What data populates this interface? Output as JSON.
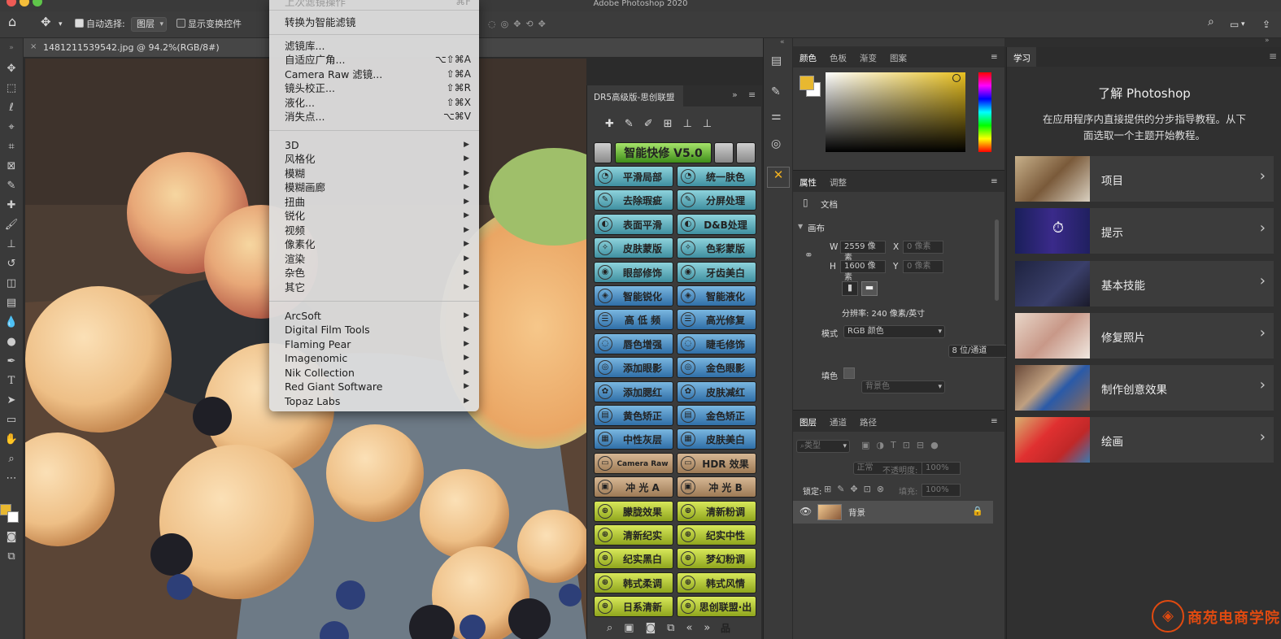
{
  "app": {
    "title": "Adobe Photoshop 2020"
  },
  "options_bar": {
    "auto_select_label": "自动选择:",
    "auto_select_value": "图层",
    "show_transform_label": "显示变换控件"
  },
  "document": {
    "tab_title": "1481211539542.jpg @ 94.2%(RGB/8#)"
  },
  "filter_menu": {
    "top_faded": "上次滤镜操作",
    "top_faded_shortcut": "⌃⌘F",
    "convert_smart": "转换为智能滤镜",
    "items": [
      {
        "label": "滤镜库...",
        "shortcut": ""
      },
      {
        "label": "自适应广角...",
        "shortcut": "⌥⇧⌘A"
      },
      {
        "label": "Camera Raw 滤镜...",
        "shortcut": "⇧⌘A"
      },
      {
        "label": "镜头校正...",
        "shortcut": "⇧⌘R"
      },
      {
        "label": "液化...",
        "shortcut": "⇧⌘X"
      },
      {
        "label": "消失点...",
        "shortcut": "⌥⌘V"
      }
    ],
    "submenus": [
      "3D",
      "风格化",
      "模糊",
      "模糊画廊",
      "扭曲",
      "锐化",
      "视频",
      "像素化",
      "渲染",
      "杂色",
      "其它"
    ],
    "plugins": [
      "ArcSoft",
      "Digital Film Tools",
      "Flaming Pear",
      "Imagenomic",
      "Nik Collection",
      "Red Giant Software",
      "Topaz Labs"
    ]
  },
  "drs_panel": {
    "title": "DR5高级版-思创联盟",
    "header_button": "智能快修 V5.0",
    "buttons": [
      [
        "平滑局部",
        "统一肤色"
      ],
      [
        "去除瑕疵",
        "分屏处理"
      ],
      [
        "表面平滑",
        "D&B处理"
      ],
      [
        "皮肤蒙版",
        "色彩蒙版"
      ],
      [
        "眼部修饰",
        "牙齿美白"
      ],
      [
        "智能锐化",
        "智能液化"
      ],
      [
        "高 低 频",
        "高光修复"
      ],
      [
        "唇色增强",
        "睫毛修饰"
      ],
      [
        "添加眼影",
        "金色眼影"
      ],
      [
        "添加腮红",
        "皮肤减红"
      ],
      [
        "黄色矫正",
        "金色矫正"
      ],
      [
        "中性灰层",
        "皮肤美白"
      ],
      [
        "Camera Raw",
        "HDR 效果"
      ],
      [
        "冲 光 A",
        "冲 光 B"
      ],
      [
        "朦胧效果",
        "清新粉调"
      ],
      [
        "清新纪实",
        "纪实中性"
      ],
      [
        "纪实黑白",
        "梦幻粉调"
      ],
      [
        "韩式柔调",
        "韩式风情"
      ],
      [
        "日系清新",
        "思创联盟·出品"
      ]
    ]
  },
  "color_panel": {
    "tabs": [
      "颜色",
      "色板",
      "渐变",
      "图案"
    ],
    "foreground": "#e8b830",
    "background": "#ffffff"
  },
  "properties_panel": {
    "tabs": [
      "属性",
      "调整"
    ],
    "doc_label": "文档",
    "section": "画布",
    "w_label": "W",
    "w_value": "2559 像素",
    "h_label": "H",
    "h_value": "1600 像素",
    "x_label": "X",
    "x_placeholder": "0 像素",
    "y_label": "Y",
    "y_placeholder": "0 像素",
    "resolution": "分辨率: 240 像素/英寸",
    "mode_label": "模式",
    "mode_value": "RGB 颜色",
    "depth_value": "8 位/通道",
    "fill_label": "填色",
    "fill_value": "背景色"
  },
  "layers_panel": {
    "tabs": [
      "图层",
      "通道",
      "路径"
    ],
    "filter_label": "类型",
    "blend_mode": "正常",
    "opacity_label": "不透明度:",
    "opacity_value": "100%",
    "lock_label": "锁定:",
    "fill_label": "填充:",
    "fill_value": "100%",
    "layer_name": "背景"
  },
  "learn_panel": {
    "tab": "学习",
    "heading": "了解 Photoshop",
    "desc_line1": "在应用程序内直接提供的分步指导教程。从下",
    "desc_line2": "面选取一个主题开始教程。",
    "items": [
      "项目",
      "提示",
      "基本技能",
      "修复照片",
      "制作创意效果",
      "绘画"
    ]
  },
  "watermark": {
    "text": "商苑电商学院"
  }
}
